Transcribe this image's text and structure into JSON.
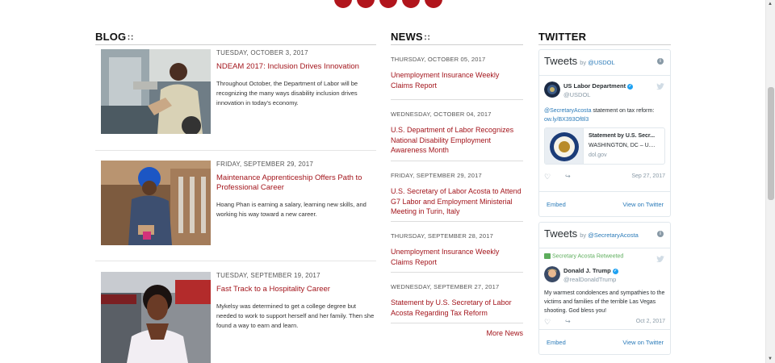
{
  "colors": {
    "accent": "#a3151c",
    "twitter_link": "#2b7bb9",
    "muted": "#8899a6"
  },
  "sections": {
    "blog": "BLOG",
    "news": "NEWS",
    "twitter": "TWITTER"
  },
  "blog": [
    {
      "date": "TUESDAY, OCTOBER 3, 2017",
      "title": "NDEAM 2017: Inclusion Drives Innovation",
      "desc": "Throughout October, the Department of Labor will be recognizing the many ways disability inclusion drives innovation in today's economy."
    },
    {
      "date": "FRIDAY, SEPTEMBER 29, 2017",
      "title": "Maintenance Apprenticeship Offers Path to Professional Career",
      "desc": "Hoang Phan is earning a salary, learning new skills, and working his way toward a new career."
    },
    {
      "date": "TUESDAY, SEPTEMBER 19, 2017",
      "title": "Fast Track to a Hospitality Career",
      "desc": "Mykelsy was determined to get a college degree but needed to work to support herself and her family. Then she found a way to earn and learn."
    }
  ],
  "news": [
    {
      "date": "THURSDAY, OCTOBER 05, 2017",
      "title": "Unemployment Insurance Weekly Claims Report"
    },
    {
      "date": "WEDNESDAY, OCTOBER 04, 2017",
      "title": "U.S. Department of Labor Recognizes National Disability Employment Awareness Month"
    },
    {
      "date": "FRIDAY, SEPTEMBER 29, 2017",
      "title": "U.S. Secretary of Labor Acosta to Attend G7 Labor and Employment Ministerial Meeting in Turin, Italy"
    },
    {
      "date": "THURSDAY, SEPTEMBER 28, 2017",
      "title": "Unemployment Insurance Weekly Claims Report"
    },
    {
      "date": "WEDNESDAY, SEPTEMBER 27, 2017",
      "title": "Statement by U.S. Secretary of Labor Acosta Regarding Tax Reform"
    }
  ],
  "more_news": "More News",
  "twitter": {
    "card1": {
      "heading": "Tweets",
      "by": "by",
      "handle": "@USDOL",
      "name": "US Labor Department",
      "user_handle": "@USDOL",
      "text_mention": "@SecretaryAcosta",
      "text_body": " statement on tax reform:",
      "text_link": "ow.ly/BX393Of8l3",
      "preview_title": "Statement by U.S. Secr...",
      "preview_sub": "WASHINGTON, DC – U....",
      "preview_domain": "dol.gov",
      "date": "Sep 27, 2017",
      "embed": "Embed",
      "view": "View on Twitter"
    },
    "card2": {
      "heading": "Tweets",
      "by": "by",
      "handle": "@SecretaryAcosta",
      "retweeted": "Secretary Acosta Retweeted",
      "name": "Donald J. Trump",
      "user_handle": "@realDonaldTrump",
      "text": "My warmest condolences and sympathies to the victims and families of the terrible Las Vegas shooting. God bless you!",
      "date": "Oct 2, 2017",
      "embed": "Embed",
      "view": "View on Twitter"
    }
  },
  "icons": {
    "rss": "rss-icon",
    "heart": "heart-icon",
    "share": "share-icon",
    "info": "info-icon",
    "bird": "twitter-bird-icon",
    "verified": "verified-badge-icon"
  }
}
